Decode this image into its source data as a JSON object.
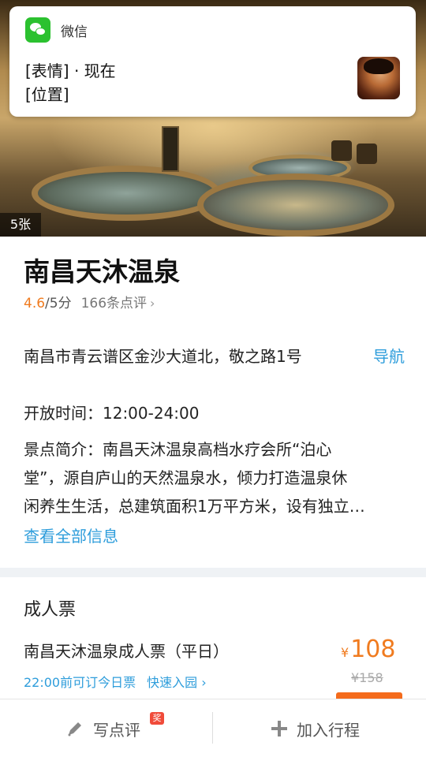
{
  "notification": {
    "app_name": "微信",
    "line1": "[表情] · 现在",
    "line2": "[位置]"
  },
  "hero": {
    "photo_count": "5张"
  },
  "attraction": {
    "title": "南昌天沐温泉",
    "score": "4.6",
    "score_suffix": "/5分",
    "review_count": "166条点评",
    "address": "南昌市青云谱区金沙大道北，敬之路1号",
    "navigate_label": "导航",
    "hours": "开放时间：12:00-24:00",
    "intro_lines": [
      "景点简介：南昌天沐温泉高档水疗会所“泊心",
      "堂”，源自庐山的天然温泉水，倾力打造温泉休",
      "闲养生生活，总建筑面积1万平方米，设有独立…"
    ],
    "view_all_label": "查看全部信息"
  },
  "tickets": {
    "section_title": "成人票",
    "items": [
      {
        "name": "南昌天沐温泉成人票（平日）",
        "tag1": "22:00前可订今日票",
        "tag2": "快速入园",
        "currency": "¥",
        "price": "108",
        "original_price": "¥158"
      }
    ]
  },
  "bottom_bar": {
    "write_review_label": "写点评",
    "reward_badge": "奖",
    "add_trip_label": "加入行程"
  },
  "colors": {
    "accent_orange": "#f07b1f",
    "link_blue": "#2e9ddb",
    "wechat_green": "#2bc12f"
  }
}
